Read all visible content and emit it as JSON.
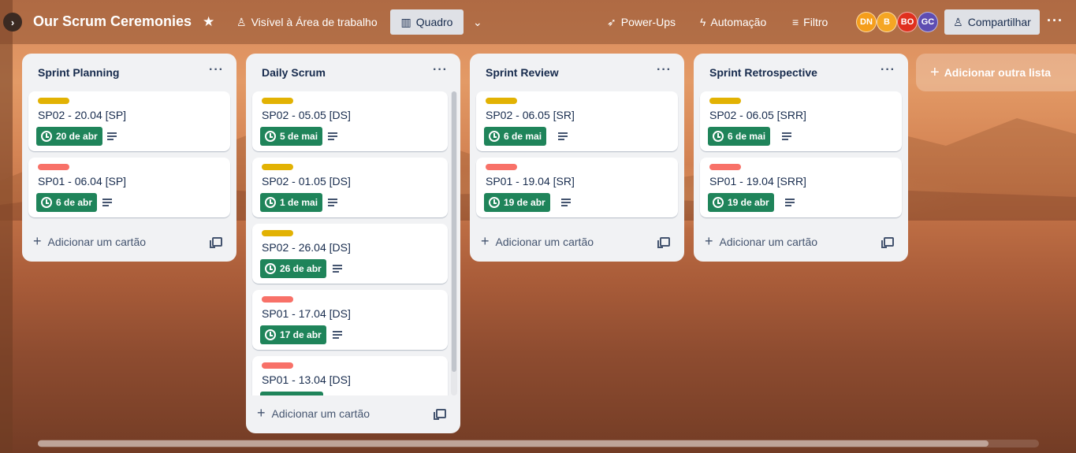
{
  "colors": {
    "yellow_label": "#e2b203",
    "red_label": "#f87168",
    "due_badge": "#1f845a",
    "avatar_dn": "#f59e1b",
    "avatar_b": "#f5a623",
    "avatar_bo": "#e0301e",
    "avatar_gc": "#5e4db2"
  },
  "header": {
    "board_title": "Our Scrum Ceremonies",
    "star_icon": "star-icon",
    "visibility_label": "Visível à Área de trabalho",
    "view_label": "Quadro",
    "powerups_label": "Power-Ups",
    "automation_label": "Automação",
    "filter_label": "Filtro",
    "share_label": "Compartilhar",
    "avatars": [
      "DN",
      "B",
      "BO",
      "GC"
    ]
  },
  "lists": [
    {
      "title": "Sprint Planning",
      "cards": [
        {
          "label": "yellow",
          "title": "SP02 - 20.04 [SP]",
          "due": "20 de abr"
        },
        {
          "label": "red",
          "title": "SP01 - 06.04 [SP]",
          "due": "6 de abr"
        }
      ],
      "add_card_label": "Adicionar um cartão"
    },
    {
      "title": "Daily Scrum",
      "cards": [
        {
          "label": "yellow",
          "title": "SP02 - 05.05 [DS]",
          "due": "5 de mai"
        },
        {
          "label": "yellow",
          "title": "SP02 - 01.05 [DS]",
          "due": "1 de mai"
        },
        {
          "label": "yellow",
          "title": "SP02 - 26.04 [DS]",
          "due": "26 de abr"
        },
        {
          "label": "red",
          "title": "SP01 - 17.04 [DS]",
          "due": "17 de abr"
        },
        {
          "label": "red",
          "title": "SP01 - 13.04 [DS]",
          "due": ""
        }
      ],
      "add_card_label": "Adicionar um cartão"
    },
    {
      "title": "Sprint Review",
      "cards": [
        {
          "label": "yellow",
          "title": "SP02 - 06.05 [SR]",
          "due": "6 de mai"
        },
        {
          "label": "red",
          "title": "SP01 - 19.04 [SR]",
          "due": "19 de abr"
        }
      ],
      "add_card_label": "Adicionar um cartão"
    },
    {
      "title": "Sprint Retrospective",
      "cards": [
        {
          "label": "yellow",
          "title": "SP02 - 06.05 [SRR]",
          "due": "6 de mai"
        },
        {
          "label": "red",
          "title": "SP01 - 19.04 [SRR]",
          "due": "19 de abr"
        }
      ],
      "add_card_label": "Adicionar um cartão"
    }
  ],
  "add_list_label": "Adicionar outra lista"
}
